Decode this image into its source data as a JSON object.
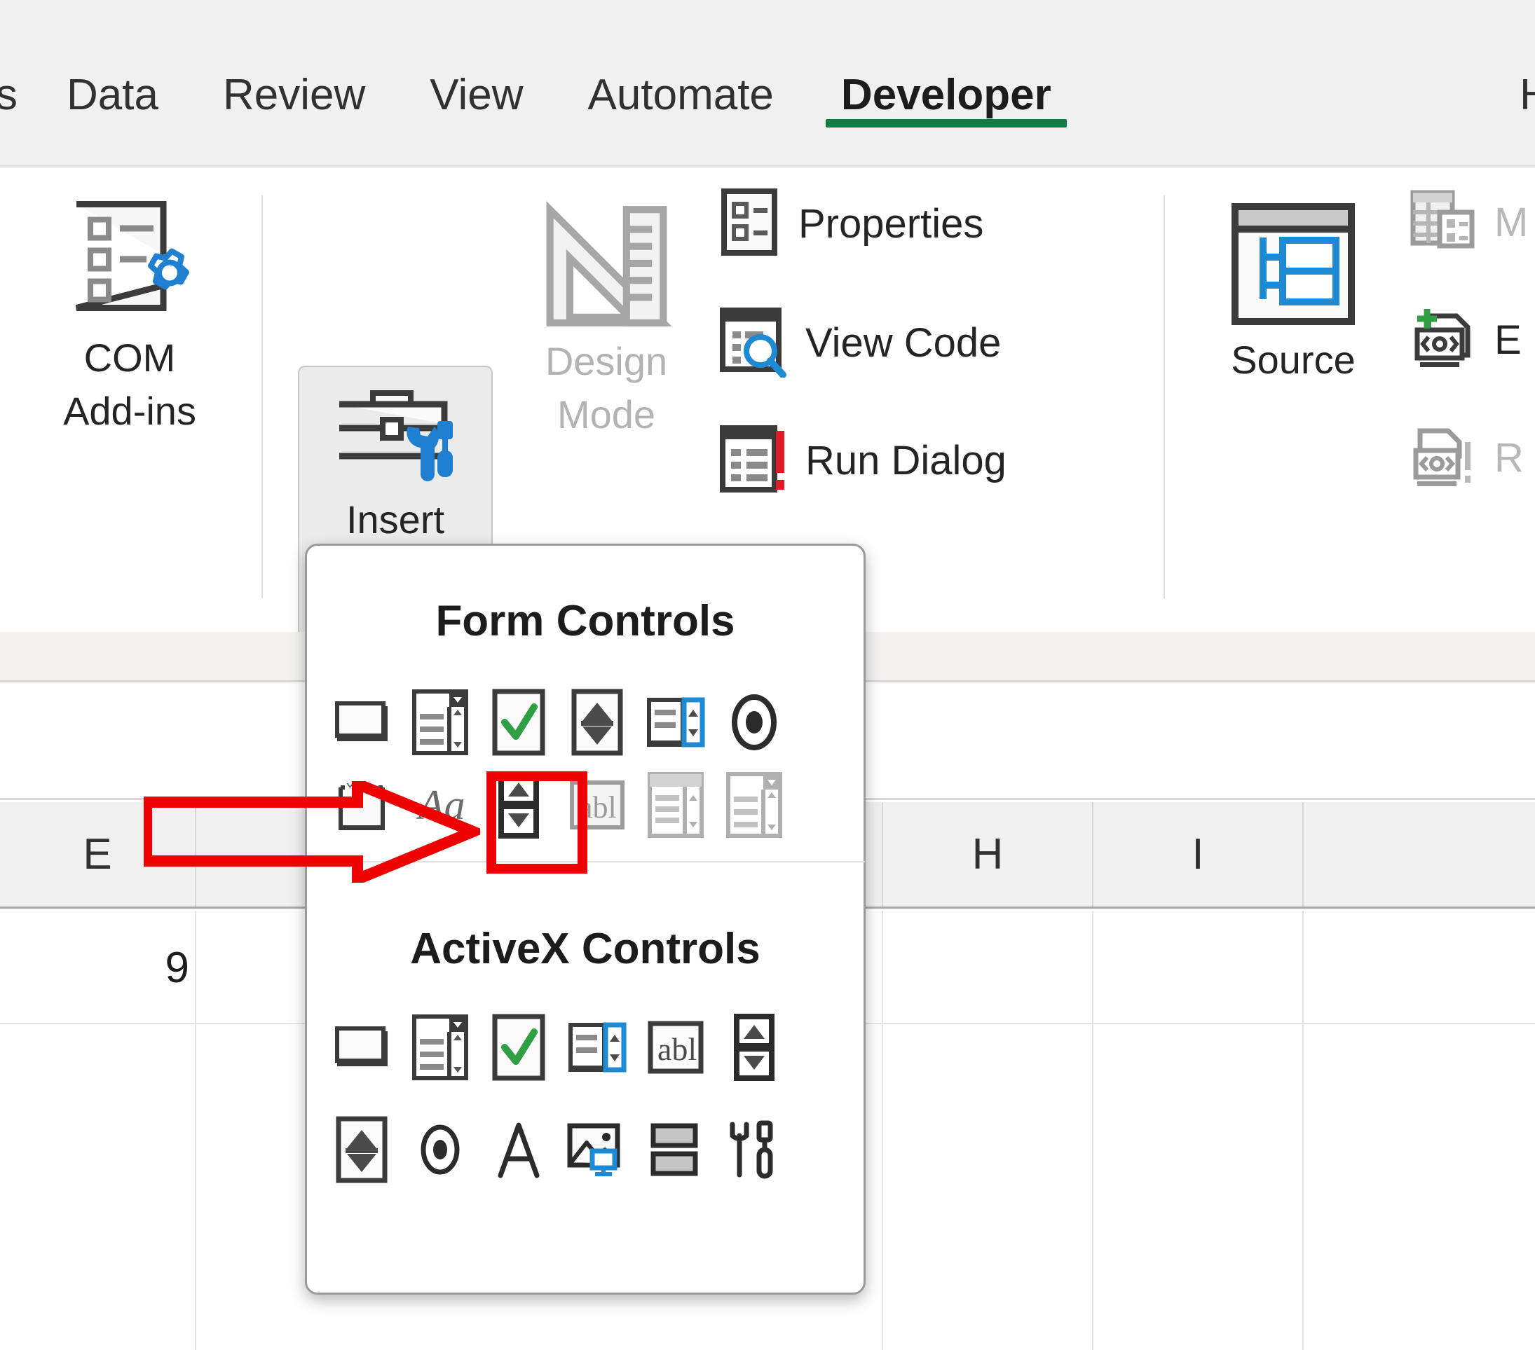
{
  "app": "Microsoft Excel",
  "ribbon": {
    "tabs": [
      {
        "label": "s",
        "active": false,
        "clipped": true
      },
      {
        "label": "Data",
        "active": false
      },
      {
        "label": "Review",
        "active": false
      },
      {
        "label": "View",
        "active": false
      },
      {
        "label": "Automate",
        "active": false
      },
      {
        "label": "Developer",
        "active": true
      }
    ],
    "tab_edge_partial": "H",
    "active_tab": "Developer",
    "accent_color": "#107c41",
    "groups": [
      {
        "name": "add-ins",
        "buttons": [
          {
            "label_line1": "COM",
            "label_line2": "Add-ins",
            "icon": "com-addins-icon",
            "enabled": true
          }
        ]
      },
      {
        "name": "controls",
        "buttons": [
          {
            "label_line1": "Insert",
            "label_line2": "",
            "icon": "insert-controls-icon",
            "enabled": true,
            "has_dropdown": true,
            "dropdown_open": true,
            "chevron": "⌄"
          },
          {
            "label_line1": "Design",
            "label_line2": "Mode",
            "icon": "design-mode-icon",
            "enabled": false
          }
        ],
        "commands": [
          {
            "label": "Properties",
            "icon": "properties-icon",
            "enabled": true
          },
          {
            "label": "View Code",
            "icon": "view-code-icon",
            "enabled": true
          },
          {
            "label": "Run Dialog",
            "icon": "run-dialog-icon",
            "enabled": true
          }
        ]
      },
      {
        "name": "xml",
        "buttons": [
          {
            "label_line1": "Source",
            "label_line2": "",
            "icon": "xml-source-icon",
            "enabled": true
          }
        ],
        "commands": [
          {
            "label": "M",
            "icon": "map-properties-icon",
            "enabled": false
          },
          {
            "label": "E",
            "icon": "expansion-packs-icon",
            "enabled": true
          },
          {
            "label": "R",
            "icon": "refresh-data-icon",
            "enabled": false
          }
        ]
      }
    ]
  },
  "insert_dropdown": {
    "sections": [
      {
        "title": "Form Controls",
        "rows": [
          [
            {
              "name": "button-form-control",
              "icon": "button-icon",
              "enabled": true
            },
            {
              "name": "combo-box-form-control",
              "icon": "combo-box-icon",
              "enabled": true
            },
            {
              "name": "check-box-form-control",
              "icon": "check-box-icon",
              "enabled": true
            },
            {
              "name": "spin-button-form-control-row1",
              "icon": "spinner-icon",
              "enabled": true
            },
            {
              "name": "list-box-form-control",
              "icon": "list-box-icon",
              "enabled": true
            },
            {
              "name": "option-button-form-control",
              "icon": "option-button-icon",
              "enabled": true
            }
          ],
          [
            {
              "name": "group-box-form-control",
              "icon": "group-box-icon",
              "enabled": true
            },
            {
              "name": "label-form-control",
              "icon": "label-aa-icon",
              "enabled": true
            },
            {
              "name": "spin-button-form-control",
              "icon": "spin-button-icon",
              "enabled": true,
              "highlighted": true
            },
            {
              "name": "text-field-form-control",
              "icon": "text-field-abl-icon",
              "enabled": false
            },
            {
              "name": "combination-list-edit-form-control",
              "icon": "combination-list-edit-icon",
              "enabled": false
            },
            {
              "name": "combination-drop-down-edit-form-control",
              "icon": "combination-drop-down-edit-icon",
              "enabled": false
            }
          ]
        ]
      },
      {
        "title": "ActiveX Controls",
        "rows": [
          [
            {
              "name": "command-button-activex",
              "icon": "button-icon",
              "enabled": true
            },
            {
              "name": "combo-box-activex",
              "icon": "combo-box-icon",
              "enabled": true
            },
            {
              "name": "check-box-activex",
              "icon": "check-box-icon",
              "enabled": true
            },
            {
              "name": "list-box-activex",
              "icon": "list-box-icon",
              "enabled": true
            },
            {
              "name": "text-box-activex",
              "icon": "text-field-abl-icon",
              "enabled": true
            },
            {
              "name": "spin-button-activex",
              "icon": "spin-button-icon",
              "enabled": true
            }
          ],
          [
            {
              "name": "scroll-bar-activex",
              "icon": "spinner-icon",
              "enabled": true
            },
            {
              "name": "option-button-activex",
              "icon": "option-button-small-icon",
              "enabled": true
            },
            {
              "name": "label-activex",
              "icon": "label-a-icon",
              "enabled": true
            },
            {
              "name": "image-activex",
              "icon": "image-icon",
              "enabled": true
            },
            {
              "name": "toggle-button-activex",
              "icon": "toggle-button-icon",
              "enabled": true
            },
            {
              "name": "more-controls-activex",
              "icon": "more-controls-icon",
              "enabled": true
            }
          ]
        ]
      }
    ]
  },
  "spreadsheet": {
    "column_headers": [
      "E",
      "H",
      "I"
    ],
    "cells": [
      {
        "value": "9"
      }
    ]
  },
  "annotations": {
    "arrow": {
      "color": "#ee0000",
      "points_to": "spin-button-form-control"
    },
    "highlight_box": {
      "color": "#ee0000",
      "target": "spin-button-form-control"
    }
  }
}
